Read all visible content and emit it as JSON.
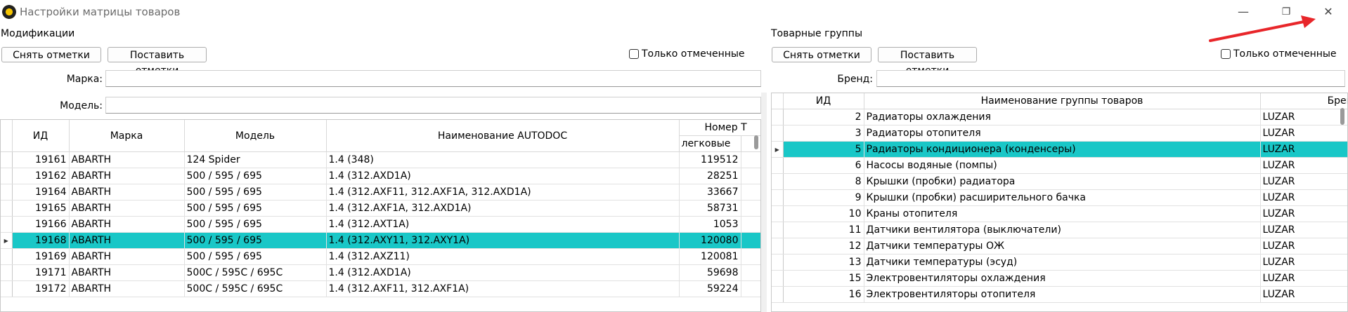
{
  "window": {
    "title": "Настройки матрицы товаров",
    "minimize": "—",
    "maximize": "❐",
    "close": "✕"
  },
  "left": {
    "section_label": "Модификации",
    "clear_marks": "Снять отметки",
    "set_marks": "Поставить отметки",
    "only_marked": "Только отмеченные",
    "brand_label": "Марка:",
    "brand_value": "",
    "model_label": "Модель:",
    "model_value": "",
    "columns": {
      "id": "ИД",
      "brand": "Марка",
      "model": "Модель",
      "autodoc": "Наименование AUTODOC",
      "number_group": "Номер Т",
      "number_sub": "легковые"
    },
    "rows": [
      {
        "id": "19161",
        "brand": "ABARTH",
        "model": "124 Spider",
        "name": "1.4 (348)",
        "num": "119512",
        "active": false
      },
      {
        "id": "19162",
        "brand": "ABARTH",
        "model": "500 / 595 / 695",
        "name": "1.4 (312.AXD1A)",
        "num": "28251",
        "active": false
      },
      {
        "id": "19164",
        "brand": "ABARTH",
        "model": "500 / 595 / 695",
        "name": "1.4 (312.AXF11, 312.AXF1A, 312.AXD1A)",
        "num": "33667",
        "active": false
      },
      {
        "id": "19165",
        "brand": "ABARTH",
        "model": "500 / 595 / 695",
        "name": "1.4 (312.AXF1A, 312.AXD1A)",
        "num": "58731",
        "active": false
      },
      {
        "id": "19166",
        "brand": "ABARTH",
        "model": "500 / 595 / 695",
        "name": "1.4 (312.AXT1A)",
        "num": "1053",
        "active": false
      },
      {
        "id": "19168",
        "brand": "ABARTH",
        "model": "500 / 595 / 695",
        "name": "1.4 (312.AXY11, 312.AXY1A)",
        "num": "120080",
        "active": true
      },
      {
        "id": "19169",
        "brand": "ABARTH",
        "model": "500 / 595 / 695",
        "name": "1.4 (312.AXZ11)",
        "num": "120081",
        "active": false
      },
      {
        "id": "19171",
        "brand": "ABARTH",
        "model": "500C / 595C / 695C",
        "name": "1.4 (312.AXD1A)",
        "num": "59698",
        "active": false
      },
      {
        "id": "19172",
        "brand": "ABARTH",
        "model": "500C / 595C / 695C",
        "name": "1.4 (312.AXF11, 312.AXF1A)",
        "num": "59224",
        "active": false
      }
    ]
  },
  "right": {
    "section_label": "Товарные группы",
    "clear_marks": "Снять отметки",
    "set_marks": "Поставить отметки",
    "only_marked": "Только отмеченные",
    "brand_label": "Бренд:",
    "brand_value": "",
    "columns": {
      "id": "ИД",
      "name": "Наименование группы товаров",
      "brand": "Бренд"
    },
    "rows": [
      {
        "id": "2",
        "name": "Радиаторы охлаждения",
        "brand": "LUZAR",
        "active": false
      },
      {
        "id": "3",
        "name": "Радиаторы отопителя",
        "brand": "LUZAR",
        "active": false
      },
      {
        "id": "5",
        "name": "Радиаторы кондиционера (конденсеры)",
        "brand": "LUZAR",
        "active": true
      },
      {
        "id": "6",
        "name": "Насосы водяные (помпы)",
        "brand": "LUZAR",
        "active": false
      },
      {
        "id": "8",
        "name": "Крышки (пробки) радиатора",
        "brand": "LUZAR",
        "active": false
      },
      {
        "id": "9",
        "name": "Крышки (пробки) расширительного бачка",
        "brand": "LUZAR",
        "active": false
      },
      {
        "id": "10",
        "name": "Краны отопителя",
        "brand": "LUZAR",
        "active": false
      },
      {
        "id": "11",
        "name": "Датчики вентилятора (выключатели)",
        "brand": "LUZAR",
        "active": false
      },
      {
        "id": "12",
        "name": "Датчики температуры ОЖ",
        "brand": "LUZAR",
        "active": false
      },
      {
        "id": "13",
        "name": "Датчики температуры (эсуд)",
        "brand": "LUZAR",
        "active": false
      },
      {
        "id": "15",
        "name": "Электровентиляторы охлаждения",
        "brand": "LUZAR",
        "active": false
      },
      {
        "id": "16",
        "name": "Электровентиляторы отопителя",
        "brand": "LUZAR",
        "active": false
      }
    ]
  },
  "colors": {
    "selection": "#19c7c7",
    "arrow": "#e8262a"
  }
}
